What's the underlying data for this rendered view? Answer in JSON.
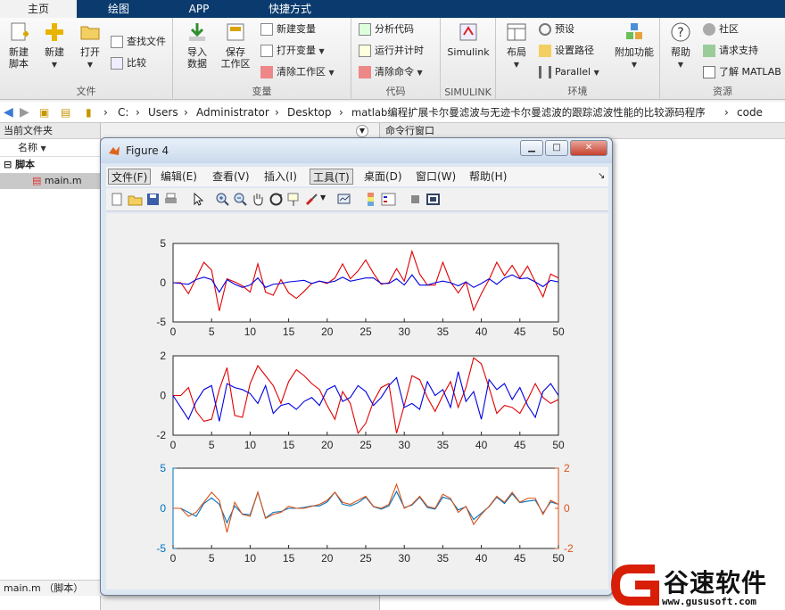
{
  "tabs": [
    "主页",
    "绘图",
    "APP",
    "快捷方式"
  ],
  "ribbon": {
    "groups": {
      "file": "文件",
      "variable": "变量",
      "code": "代码",
      "simulink": "SIMULINK",
      "env": "环境",
      "resource": "资源"
    },
    "new_script": [
      "新建",
      "脚本"
    ],
    "new": "新建",
    "open": "打开",
    "find_files": "查找文件",
    "compare": "比较",
    "import": [
      "导入",
      "数据"
    ],
    "save_ws": [
      "保存",
      "工作区"
    ],
    "new_var": "新建变量",
    "open_var": "打开变量",
    "clear_ws": "清除工作区",
    "analyze": "分析代码",
    "run_time": "运行并计时",
    "clear_cmd": "清除命令",
    "simulink": "Simulink",
    "layout": "布局",
    "prefs": "预设",
    "set_path": "设置路径",
    "parallel": "Parallel",
    "addons": "附加功能",
    "help": "帮助",
    "community": "社区",
    "support": "请求支持",
    "learn": "了解 MATLAB"
  },
  "address": [
    "C:",
    "Users",
    "Administrator",
    "Desktop",
    "matlab编程扩展卡尔曼滤波与无迹卡尔曼滤波的跟踪滤波性能的比较源码程序",
    "code"
  ],
  "left_panel": {
    "title": "当前文件夹",
    "col_name": "名称",
    "folder": "脚本",
    "file": "main.m",
    "status": "main.m （脚本）"
  },
  "cmd_panel": {
    "title": "命令行窗口"
  },
  "figure": {
    "title": "Figure 4",
    "menus": [
      "文件(F)",
      "编辑(E)",
      "查看(V)",
      "插入(I)",
      "工具(T)",
      "桌面(D)",
      "窗口(W)",
      "帮助(H)"
    ]
  },
  "watermark": {
    "name": "谷速软件",
    "url": "www.gususoft.com"
  },
  "colors": {
    "red": "#e00000",
    "blue": "#0000e0",
    "yy_left": "#0072bd",
    "yy_right": "#d95319"
  },
  "chart_data": [
    {
      "type": "line",
      "x": [
        1,
        2,
        3,
        4,
        5,
        6,
        7,
        8,
        9,
        10,
        11,
        12,
        13,
        14,
        15,
        16,
        17,
        18,
        19,
        20,
        21,
        22,
        23,
        24,
        25,
        26,
        27,
        28,
        29,
        30,
        31,
        32,
        33,
        34,
        35,
        36,
        37,
        38,
        39,
        40,
        41,
        42,
        43,
        44,
        45,
        46,
        47,
        48,
        49,
        50
      ],
      "series": [
        {
          "color": "red",
          "values": [
            0,
            0,
            -1.4,
            0.6,
            2.6,
            1.6,
            -3.6,
            0.5,
            0.1,
            -0.4,
            -1.2,
            2.4,
            -1.2,
            -1.6,
            0.4,
            -1.3,
            -2,
            -1.1,
            -0.1,
            0.2,
            -0.1,
            0.6,
            2.4,
            0.5,
            1.5,
            2.9,
            1.2,
            -0.2,
            0,
            1.8,
            0.2,
            4,
            1.1,
            -0.3,
            -0.3,
            2.6,
            0.1,
            -1.3,
            0.1,
            -3.5,
            -1.4,
            0.4,
            2.6,
            0.9,
            2.2,
            0.6,
            2.1,
            0.1,
            -1.8,
            1.1,
            0.6
          ]
        },
        {
          "color": "blue",
          "values": [
            0,
            -0.1,
            -0.2,
            0.4,
            0.7,
            0.4,
            -1.2,
            0.4,
            -0.2,
            -0.6,
            -0.3,
            0.6,
            -0.6,
            -0.2,
            -0.1,
            0.1,
            0.2,
            0.3,
            -0.1,
            0.2,
            0,
            0.2,
            0.7,
            0.2,
            0.4,
            0.6,
            0.6,
            -0.1,
            -0.1,
            0.5,
            -0.3,
            1.0,
            -0.3,
            -0.3,
            0,
            0.2,
            0,
            -0.4,
            0.1,
            -0.6,
            -0.1,
            0.5,
            -0.2,
            0.6,
            1,
            0.5,
            0.6,
            0.1,
            -0.5,
            0.3,
            0.1
          ]
        }
      ],
      "xlim": [
        0,
        50
      ],
      "ylim": [
        -5,
        5
      ],
      "xticks": [
        0,
        5,
        10,
        15,
        20,
        25,
        30,
        35,
        40,
        45,
        50
      ],
      "yticks": [
        -5,
        0,
        5
      ]
    },
    {
      "type": "line",
      "x": [
        1,
        2,
        3,
        4,
        5,
        6,
        7,
        8,
        9,
        10,
        11,
        12,
        13,
        14,
        15,
        16,
        17,
        18,
        19,
        20,
        21,
        22,
        23,
        24,
        25,
        26,
        27,
        28,
        29,
        30,
        31,
        32,
        33,
        34,
        35,
        36,
        37,
        38,
        39,
        40,
        41,
        42,
        43,
        44,
        45,
        46,
        47,
        48,
        49,
        50
      ],
      "series": [
        {
          "color": "red",
          "values": [
            0,
            0,
            0.4,
            -0.8,
            -1.3,
            -1.2,
            0.3,
            1.4,
            -1,
            -1.1,
            0.6,
            1.5,
            1.0,
            0.5,
            -0.4,
            0.7,
            1.3,
            1.0,
            0.6,
            0.3,
            -0.5,
            -1.2,
            0.2,
            -0.4,
            -1.9,
            -1.4,
            -0.3,
            0.4,
            0.6,
            -1.9,
            -0.5,
            1.0,
            0.8,
            -0.1,
            -0.8,
            0,
            0.7,
            -0.6,
            0.4,
            1.9,
            1.6,
            0.4,
            -0.9,
            -0.5,
            -0.6,
            -0.9,
            -0.2,
            0.6,
            -0.1,
            -0.4,
            -0.2
          ]
        },
        {
          "color": "blue",
          "values": [
            0,
            -0.6,
            -1.2,
            -0.3,
            0.3,
            0.5,
            -1.3,
            0.6,
            0.4,
            0.3,
            0.1,
            -0.4,
            0.5,
            -0.9,
            -0.5,
            -0.4,
            -0.7,
            -0.3,
            -0.1,
            -0.5,
            0.3,
            0.5,
            -0.3,
            -0.1,
            0.5,
            0.2,
            -0.5,
            -0.1,
            0.5,
            0.9,
            -0.6,
            -0.4,
            -0.7,
            0.7,
            0,
            0.3,
            -0.6,
            1.2,
            -0.3,
            0.2,
            -1.2,
            0.8,
            0.3,
            0.6,
            -0.2,
            0.4,
            -0.5,
            -1.1,
            0.2,
            0.6,
            0
          ]
        }
      ],
      "xlim": [
        0,
        50
      ],
      "ylim": [
        -2,
        2
      ],
      "xticks": [
        0,
        5,
        10,
        15,
        20,
        25,
        30,
        35,
        40,
        45,
        50
      ],
      "yticks": [
        -2,
        0,
        2
      ]
    },
    {
      "type": "line",
      "x": [
        1,
        2,
        3,
        4,
        5,
        6,
        7,
        8,
        9,
        10,
        11,
        12,
        13,
        14,
        15,
        16,
        17,
        18,
        19,
        20,
        21,
        22,
        23,
        24,
        25,
        26,
        27,
        28,
        29,
        30,
        31,
        32,
        33,
        34,
        35,
        36,
        37,
        38,
        39,
        40,
        41,
        42,
        43,
        44,
        45,
        46,
        47,
        48,
        49,
        50
      ],
      "series": [
        {
          "color": "yy_left",
          "values": [
            0,
            0,
            -0.5,
            -1,
            0.6,
            1.3,
            0.5,
            -1.8,
            0.3,
            -0.7,
            -0.8,
            2.0,
            -1.2,
            -0.5,
            -0.4,
            0,
            0,
            0.1,
            0.3,
            0.3,
            0.8,
            2.0,
            0.5,
            0.3,
            0.7,
            1.4,
            0.2,
            -0.1,
            0.3,
            2.1,
            0.1,
            0.4,
            1.4,
            0.1,
            -0.1,
            1.4,
            1.1,
            -0.2,
            0.2,
            -1.4,
            -0.6,
            0.2,
            1.4,
            0.6,
            1.8,
            0.7,
            0.9,
            1.0,
            -0.6,
            0.8,
            0.5
          ]
        },
        {
          "color": "yy_right",
          "values": [
            0,
            0,
            -0.4,
            -0.2,
            0.3,
            0.8,
            0.4,
            -1.2,
            0.3,
            -0.3,
            -0.4,
            0.8,
            -0.5,
            -0.3,
            -0.2,
            0.1,
            0,
            0,
            0.1,
            0.2,
            0.4,
            0.8,
            0.3,
            0.2,
            0.4,
            0.6,
            0.1,
            0,
            0.2,
            1.2,
            0,
            0.2,
            0.6,
            0.1,
            0,
            0.7,
            0.5,
            -0.2,
            0.1,
            -0.8,
            -0.3,
            0.1,
            0.6,
            0.3,
            0.8,
            0.3,
            0.5,
            0.5,
            -0.3,
            0.4,
            0.2
          ]
        }
      ],
      "xlim": [
        0,
        50
      ],
      "ylim_left": [
        -5,
        5
      ],
      "ylim_right": [
        -2,
        2
      ],
      "xticks": [
        0,
        5,
        10,
        15,
        20,
        25,
        30,
        35,
        40,
        45,
        50
      ],
      "yticks_left": [
        -5,
        0,
        5
      ],
      "yticks_right": [
        -2,
        0,
        2
      ]
    }
  ]
}
